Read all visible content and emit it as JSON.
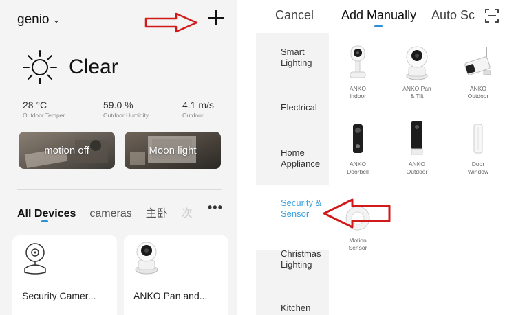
{
  "left": {
    "home_name": "genio",
    "weather": {
      "condition": "Clear",
      "stats": [
        {
          "value": "28 °C",
          "label": "Outdoor Temper..."
        },
        {
          "value": "59.0 %",
          "label": "Outdoor Humidity"
        },
        {
          "value": "4.1 m/s",
          "label": "Outdoor..."
        }
      ]
    },
    "scenes": [
      "motion off",
      "Moon light"
    ],
    "tabs": [
      "All Devices",
      "cameras",
      "主卧",
      "次"
    ],
    "devices": [
      "Security Camer...",
      "ANKO Pan and..."
    ]
  },
  "right": {
    "cancel": "Cancel",
    "add_manually": "Add Manually",
    "auto_scan": "Auto Sc",
    "categories": [
      "Smart Lighting",
      "Electrical",
      "Home Appliance",
      "Security & Sensor",
      "Christmas Lighting",
      "Kitchen"
    ],
    "products": [
      {
        "line1": "ANKO",
        "line2": "Indoor"
      },
      {
        "line1": "ANKO Pan",
        "line2": "& Tilt"
      },
      {
        "line1": "ANKO",
        "line2": "Outdoor"
      },
      {
        "line1": "ANKO",
        "line2": "Doorbell"
      },
      {
        "line1": "ANKO",
        "line2": "Outdoor"
      },
      {
        "line1": "Door",
        "line2": "Window"
      },
      {
        "line1": "Motion",
        "line2": "Sensor"
      }
    ]
  },
  "colors": {
    "accent": "#2f8fd6",
    "active_category": "#3aa0dc",
    "annotation_arrow": "#d11a1a"
  }
}
